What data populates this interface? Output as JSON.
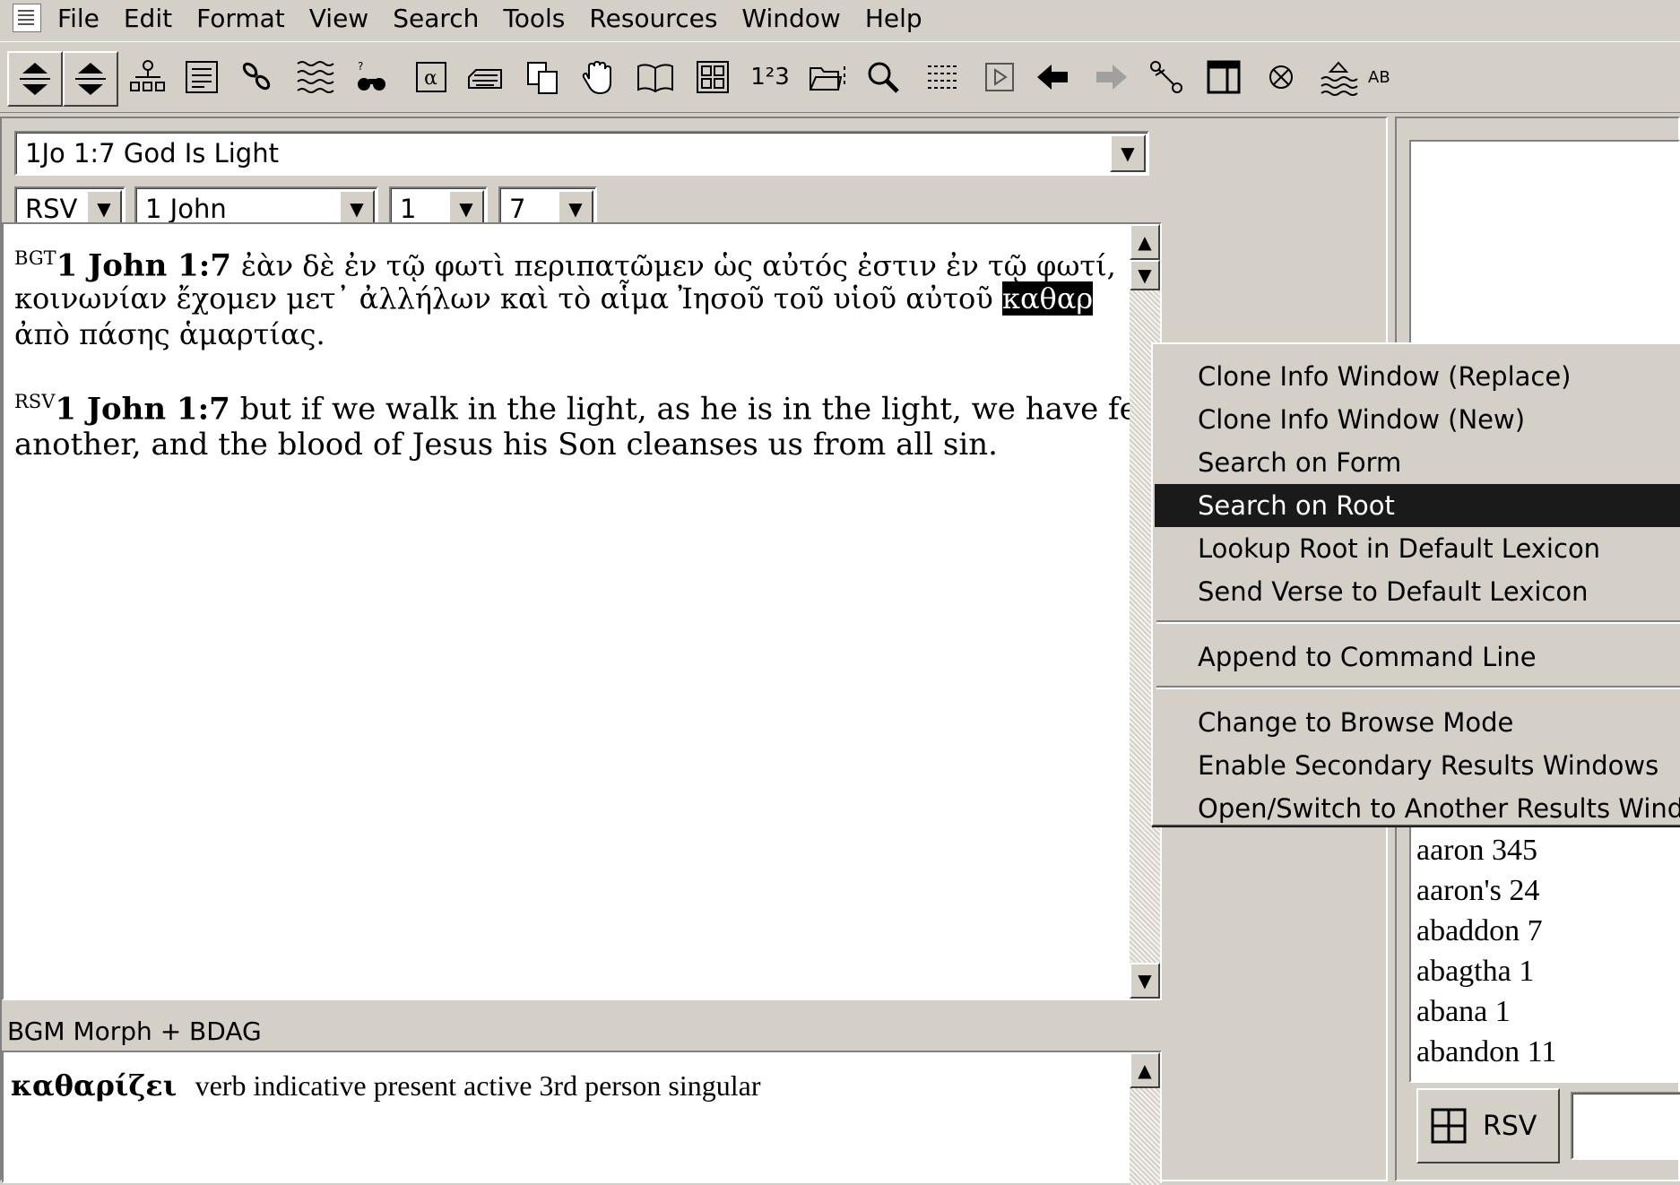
{
  "menubar": {
    "items": [
      "File",
      "Edit",
      "Format",
      "View",
      "Search",
      "Tools",
      "Resources",
      "Window",
      "Help"
    ]
  },
  "toolbar": {
    "buttons": [
      {
        "icon": "up-down-arrows-icon"
      },
      {
        "icon": "up-down-arrows-icon"
      },
      {
        "icon": "tree-icon"
      },
      {
        "icon": "list-icon"
      },
      {
        "icon": "links-icon"
      },
      {
        "icon": "stack-icon"
      },
      {
        "icon": "binoculars-icon"
      },
      {
        "icon": "alpha-icon",
        "glyph": "α"
      },
      {
        "icon": "keyboard-icon"
      },
      {
        "icon": "copy-icon"
      },
      {
        "icon": "hand-icon"
      },
      {
        "icon": "book-icon"
      },
      {
        "icon": "grid-icon"
      },
      {
        "icon": "numbering-icon",
        "glyph": "1²3"
      },
      {
        "icon": "folder-icon"
      },
      {
        "icon": "magnifier-icon"
      },
      {
        "icon": "columns-icon"
      },
      {
        "icon": "play-icon"
      },
      {
        "icon": "back-arrow-icon"
      },
      {
        "icon": "forward-arrow-icon"
      },
      {
        "icon": "scissors-icon"
      },
      {
        "icon": "window-icon"
      },
      {
        "icon": "cancel-icon"
      },
      {
        "icon": "layers-icon"
      },
      {
        "icon": "abc-icon",
        "glyph": "AB"
      }
    ]
  },
  "passage": {
    "title": "1Jo 1:7 God Is Light",
    "version": "RSV",
    "book": "1 John",
    "chapter": "1",
    "verse": "7"
  },
  "verses": {
    "bgt": {
      "tag": "BGT",
      "ref": "1 John 1:7",
      "line1": "ἐὰν δὲ ἐν τῷ φωτὶ περιπατῶμεν ὡς αὐτός ἐστιν ἐν τῷ φωτί,",
      "line2_pre": "κοινωνίαν ἔχομεν μετ᾽ ἀλλήλων καὶ τὸ αἷμα Ἰησοῦ τοῦ υἱοῦ αὐτοῦ",
      "highlight": "καθαρ",
      "line3": "ἀπὸ πάσης ἁμαρτίας."
    },
    "rsv": {
      "tag": "RSV",
      "ref": "1 John 1:7",
      "line1": "but if we walk in the light, as he is in the light, we have fellowshi",
      "line2": "another, and the blood of Jesus his Son cleanses us from all sin."
    }
  },
  "analysis": {
    "header": "BGM Morph  + BDAG",
    "word": "καθαρίζει",
    "parse": "verb indicative present active 3rd person singular"
  },
  "wordlist": [
    "aaron 345",
    "aaron's 24",
    "abaddon 7",
    "abagtha 1",
    "abana 1",
    "abandon 11"
  ],
  "right_footer": {
    "version_label": "RSV"
  },
  "context_menu": {
    "items": [
      "Clone Info Window (Replace)",
      "Clone Info Window (New)",
      "Search on Form",
      "Search on Root",
      "Lookup Root in Default Lexicon",
      "Send Verse to Default Lexicon",
      "Append to Command Line",
      "Change to Browse Mode",
      "Enable Secondary Results Windows",
      "Open/Switch to Another Results Window"
    ],
    "selected": "Search on Root"
  }
}
